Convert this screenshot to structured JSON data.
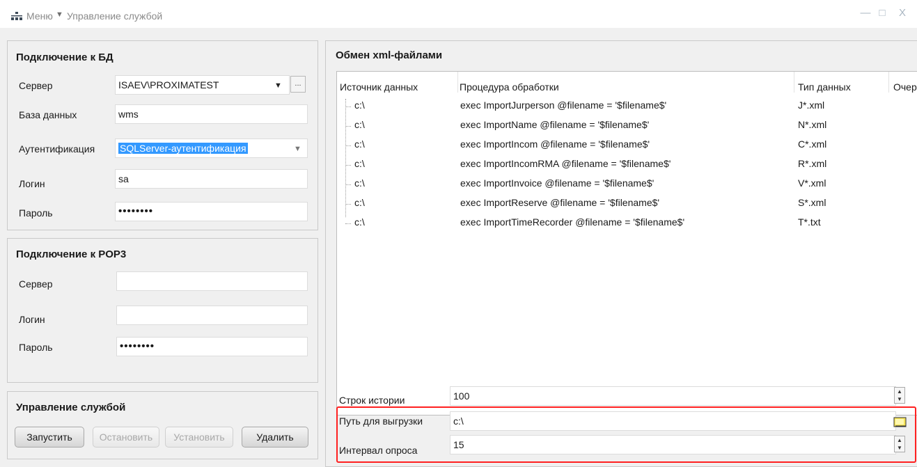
{
  "window": {
    "menu_label": "Меню",
    "menu_arrow": "▼",
    "title": "Управление службой",
    "minimize": "—",
    "maximize": "□",
    "close": "X"
  },
  "db": {
    "title": "Подключение к БД",
    "server_label": "Сервер",
    "server_value": "ISAEV\\PROXIMATEST",
    "server_arrow": "▼",
    "browse_label": "...",
    "database_label": "База данных",
    "database_value": "wms",
    "auth_label": "Аутентификация",
    "auth_value": "SQLServer-аутентификация",
    "auth_arrow": "▼",
    "login_label": "Логин",
    "login_value": "sa",
    "password_label": "Пароль",
    "password_value": "••••••••"
  },
  "pop3": {
    "title": "Подключение к POP3",
    "server_label": "Сервер",
    "server_value": "",
    "login_label": "Логин",
    "login_value": "",
    "password_label": "Пароль",
    "password_value": "••••••••"
  },
  "service": {
    "title": "Управление службой",
    "start": "Запустить",
    "stop": "Остановить",
    "install": "Установить",
    "delete": "Удалить"
  },
  "exchange": {
    "title": "Обмен xml-файлами",
    "columns": [
      "Источник данных",
      "Процедура обработки",
      "Тип данных",
      "Очер"
    ],
    "rows": [
      {
        "source": "c:\\",
        "procedure": "exec ImportJurperson @filename = '$filename$'",
        "type": "J*.xml"
      },
      {
        "source": "c:\\",
        "procedure": "exec ImportName @filename = '$filename$'",
        "type": "N*.xml"
      },
      {
        "source": "c:\\",
        "procedure": "exec ImportIncom @filename = '$filename$'",
        "type": "C*.xml"
      },
      {
        "source": "c:\\",
        "procedure": "exec ImportIncomRMA @filename = '$filename$'",
        "type": "R*.xml"
      },
      {
        "source": "c:\\",
        "procedure": "exec ImportInvoice @filename = '$filename$'",
        "type": "V*.xml"
      },
      {
        "source": "c:\\",
        "procedure": "exec ImportReserve @filename = '$filename$'",
        "type": "S*.xml"
      },
      {
        "source": "c:\\",
        "procedure": "exec ImportTimeRecorder @filename = '$filename$'",
        "type": "T*.txt"
      }
    ],
    "history_label": "Строк истории",
    "history_value": "100",
    "export_path_label": "Путь для выгрузки",
    "export_path_value": "c:\\",
    "poll_interval_label": "Интервал опроса",
    "poll_interval_value": "15",
    "spin_up": "▲",
    "spin_down": "▼"
  },
  "colors": {
    "highlight": "#ff2020",
    "selection": "#3399ff"
  }
}
